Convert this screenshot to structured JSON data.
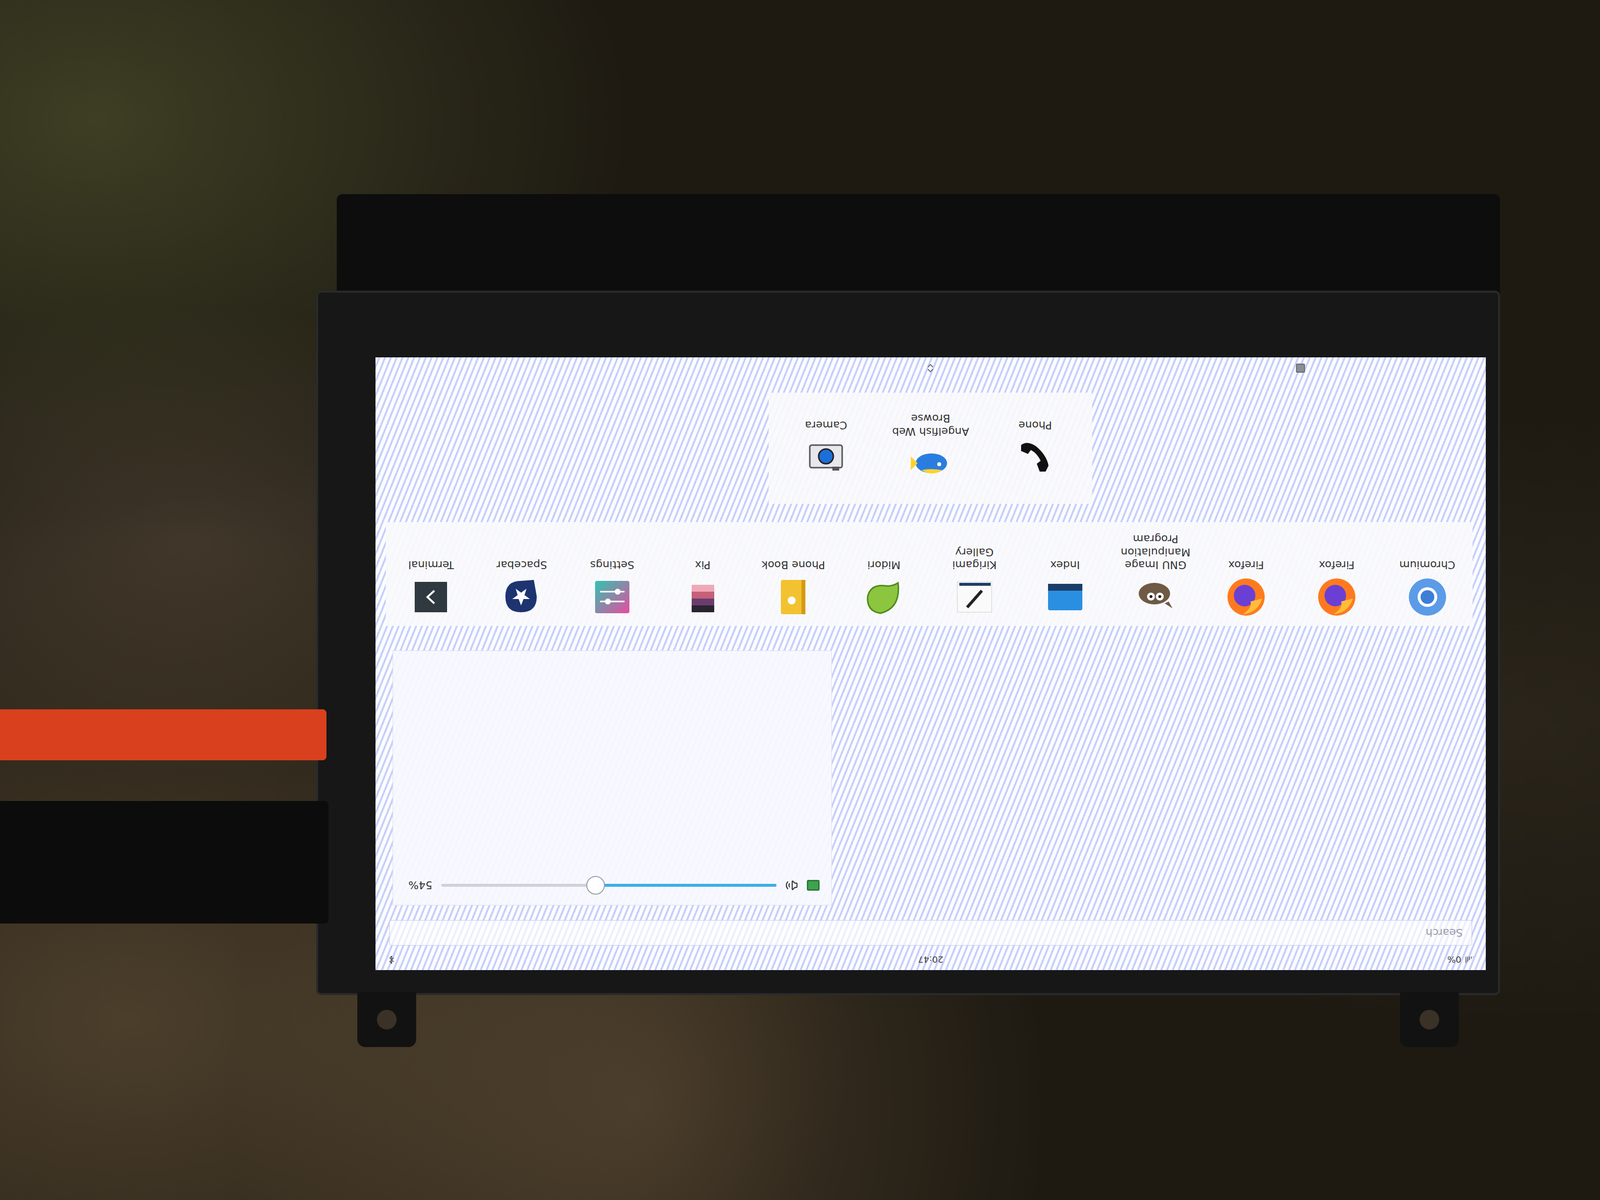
{
  "status_bar": {
    "battery": "0%",
    "time": "20:47"
  },
  "search": {
    "placeholder": "Search"
  },
  "quick_settings": {
    "volume": {
      "level": 0.54,
      "reading": "54%"
    }
  },
  "app_drawer": {
    "apps": [
      {
        "label": "Chromium"
      },
      {
        "label": "Firefox"
      },
      {
        "label": "Firefox"
      },
      {
        "label": "GNU Image Manipulation Program"
      },
      {
        "label": "Index"
      },
      {
        "label": "Kirigami Gallery"
      },
      {
        "label": "Midori"
      },
      {
        "label": "Phone Book"
      },
      {
        "label": "Pix"
      },
      {
        "label": "Settings"
      },
      {
        "label": "Spacebar"
      },
      {
        "label": "Terminal"
      }
    ]
  },
  "favorites": {
    "apps": [
      {
        "label": "Phone"
      },
      {
        "label": "Angelfish Web Browse"
      },
      {
        "label": "Camera"
      }
    ]
  }
}
